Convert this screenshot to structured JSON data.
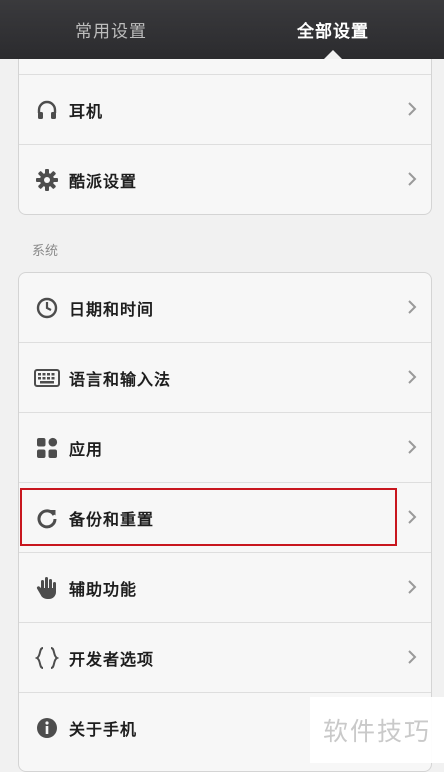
{
  "tabs": [
    {
      "label": "常用设置",
      "active": false
    },
    {
      "label": "全部设置",
      "active": true
    }
  ],
  "top_group": {
    "items": [
      {
        "label": "耳机",
        "icon": "headphones-icon"
      },
      {
        "label": "酷派设置",
        "icon": "gear-icon"
      }
    ]
  },
  "system_section": {
    "title": "系统",
    "items": [
      {
        "label": "日期和时间",
        "icon": "clock-icon"
      },
      {
        "label": "语言和输入法",
        "icon": "keyboard-icon"
      },
      {
        "label": "应用",
        "icon": "apps-grid-icon"
      },
      {
        "label": "备份和重置",
        "icon": "backup-refresh-icon",
        "highlighted": true
      },
      {
        "label": "辅助功能",
        "icon": "hand-icon"
      },
      {
        "label": "开发者选项",
        "icon": "braces-icon"
      },
      {
        "label": "关于手机",
        "icon": "info-icon"
      }
    ]
  },
  "watermark": {
    "text": "软件技巧"
  },
  "colors": {
    "highlight": "#c8161e",
    "tabbar": "#2f2f32",
    "icon": "#4d4d4d"
  }
}
